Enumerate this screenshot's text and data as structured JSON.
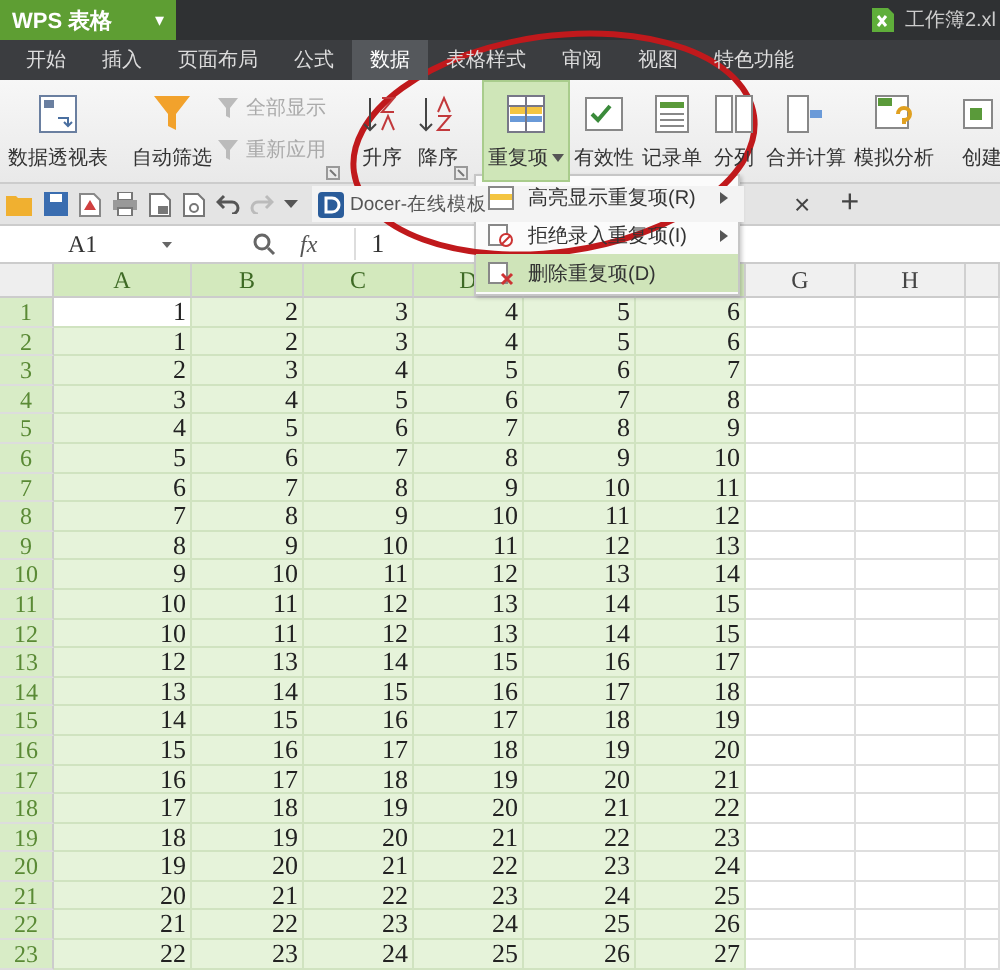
{
  "app_button": {
    "label": "WPS 表格",
    "caret": "▾"
  },
  "document_title": "工作簿2.xl",
  "tabs": [
    {
      "label": "开始",
      "selected": false
    },
    {
      "label": "插入",
      "selected": false
    },
    {
      "label": "页面布局",
      "selected": false
    },
    {
      "label": "公式",
      "selected": false
    },
    {
      "label": "数据",
      "selected": true
    },
    {
      "label": "表格样式",
      "selected": false
    },
    {
      "label": "审阅",
      "selected": false
    },
    {
      "label": "视图",
      "selected": false
    },
    {
      "label": "特色功能",
      "selected": false
    }
  ],
  "ribbon": {
    "groups": [
      {
        "launcher": false,
        "items": [
          {
            "kind": "large",
            "label": "数据透视表",
            "active": false,
            "dropdown": false
          }
        ]
      },
      {
        "launcher": true,
        "items": [
          {
            "kind": "large",
            "label": "自动筛选",
            "active": false,
            "dropdown": false
          },
          {
            "kind": "stack",
            "items": [
              {
                "label": "全部显示",
                "disabled": true
              },
              {
                "label": "重新应用",
                "disabled": true
              }
            ]
          }
        ]
      },
      {
        "launcher": true,
        "items": [
          {
            "kind": "large",
            "label": "升序",
            "active": false,
            "dropdown": false
          },
          {
            "kind": "large",
            "label": "降序",
            "active": false,
            "dropdown": false
          }
        ]
      },
      {
        "launcher": false,
        "items": [
          {
            "kind": "large",
            "label": "重复项",
            "active": true,
            "dropdown": true
          },
          {
            "kind": "large",
            "label": "有效性",
            "active": false,
            "dropdown": false
          },
          {
            "kind": "large",
            "label": "记录单",
            "active": false,
            "dropdown": false
          },
          {
            "kind": "large",
            "label": "分列",
            "active": false,
            "dropdown": false
          },
          {
            "kind": "large",
            "label": "合并计算",
            "active": false,
            "dropdown": false
          },
          {
            "kind": "large",
            "label": "模拟分析",
            "active": false,
            "dropdown": false
          }
        ]
      },
      {
        "launcher": false,
        "items": [
          {
            "kind": "large",
            "label": "创建",
            "active": false,
            "dropdown": false
          }
        ]
      }
    ]
  },
  "quick_toolbar": {
    "doc_tab": "Docer-在线模板",
    "close": "×",
    "new_tab": "+"
  },
  "formula_bar": {
    "cell_ref": "A1",
    "fx": "fx",
    "value": "1"
  },
  "menu": {
    "items": [
      {
        "label": "高亮显示重复项(R)",
        "submenu": true,
        "selected": false
      },
      {
        "label": "拒绝录入重复项(I)",
        "submenu": true,
        "selected": false
      },
      {
        "label": "删除重复项(D)",
        "submenu": false,
        "selected": true
      }
    ]
  },
  "sheet": {
    "columns": [
      {
        "label": "A",
        "selected": true
      },
      {
        "label": "B",
        "selected": true
      },
      {
        "label": "C",
        "selected": true
      },
      {
        "label": "D",
        "selected": true
      },
      {
        "selected": true
      },
      {
        "selected": true
      },
      {
        "label": "G",
        "selected": false
      },
      {
        "label": "H",
        "selected": false
      }
    ],
    "rows": [
      {
        "number": "1",
        "selected": true,
        "cells": [
          {
            "text": "1",
            "active": true
          },
          {
            "text": "2",
            "active": false
          },
          {
            "text": "3",
            "active": false
          },
          {
            "text": "4",
            "active": false
          },
          {
            "text": "5",
            "active": false
          },
          {
            "text": "6",
            "active": false
          }
        ]
      },
      {
        "number": "2",
        "selected": true,
        "cells": [
          {
            "text": "1",
            "active": false
          },
          {
            "text": "2",
            "active": false
          },
          {
            "text": "3",
            "active": false
          },
          {
            "text": "4",
            "active": false
          },
          {
            "text": "5",
            "active": false
          },
          {
            "text": "6",
            "active": false
          }
        ]
      },
      {
        "number": "3",
        "selected": true,
        "cells": [
          {
            "text": "2",
            "active": false
          },
          {
            "text": "3",
            "active": false
          },
          {
            "text": "4",
            "active": false
          },
          {
            "text": "5",
            "active": false
          },
          {
            "text": "6",
            "active": false
          },
          {
            "text": "7",
            "active": false
          }
        ]
      },
      {
        "number": "4",
        "selected": true,
        "cells": [
          {
            "text": "3",
            "active": false
          },
          {
            "text": "4",
            "active": false
          },
          {
            "text": "5",
            "active": false
          },
          {
            "text": "6",
            "active": false
          },
          {
            "text": "7",
            "active": false
          },
          {
            "text": "8",
            "active": false
          }
        ]
      },
      {
        "number": "5",
        "selected": true,
        "cells": [
          {
            "text": "4",
            "active": false
          },
          {
            "text": "5",
            "active": false
          },
          {
            "text": "6",
            "active": false
          },
          {
            "text": "7",
            "active": false
          },
          {
            "text": "8",
            "active": false
          },
          {
            "text": "9",
            "active": false
          }
        ]
      },
      {
        "number": "6",
        "selected": true,
        "cells": [
          {
            "text": "5",
            "active": false
          },
          {
            "text": "6",
            "active": false
          },
          {
            "text": "7",
            "active": false
          },
          {
            "text": "8",
            "active": false
          },
          {
            "text": "9",
            "active": false
          },
          {
            "text": "10",
            "active": false
          }
        ]
      },
      {
        "number": "7",
        "selected": true,
        "cells": [
          {
            "text": "6",
            "active": false
          },
          {
            "text": "7",
            "active": false
          },
          {
            "text": "8",
            "active": false
          },
          {
            "text": "9",
            "active": false
          },
          {
            "text": "10",
            "active": false
          },
          {
            "text": "11",
            "active": false
          }
        ]
      },
      {
        "number": "8",
        "selected": true,
        "cells": [
          {
            "text": "7",
            "active": false
          },
          {
            "text": "8",
            "active": false
          },
          {
            "text": "9",
            "active": false
          },
          {
            "text": "10",
            "active": false
          },
          {
            "text": "11",
            "active": false
          },
          {
            "text": "12",
            "active": false
          }
        ]
      },
      {
        "number": "9",
        "selected": true,
        "cells": [
          {
            "text": "8",
            "active": false
          },
          {
            "text": "9",
            "active": false
          },
          {
            "text": "10",
            "active": false
          },
          {
            "text": "11",
            "active": false
          },
          {
            "text": "12",
            "active": false
          },
          {
            "text": "13",
            "active": false
          }
        ]
      },
      {
        "number": "10",
        "selected": true,
        "cells": [
          {
            "text": "9",
            "active": false
          },
          {
            "text": "10",
            "active": false
          },
          {
            "text": "11",
            "active": false
          },
          {
            "text": "12",
            "active": false
          },
          {
            "text": "13",
            "active": false
          },
          {
            "text": "14",
            "active": false
          }
        ]
      },
      {
        "number": "11",
        "selected": true,
        "cells": [
          {
            "text": "10",
            "active": false
          },
          {
            "text": "11",
            "active": false
          },
          {
            "text": "12",
            "active": false
          },
          {
            "text": "13",
            "active": false
          },
          {
            "text": "14",
            "active": false
          },
          {
            "text": "15",
            "active": false
          }
        ]
      },
      {
        "number": "12",
        "selected": true,
        "cells": [
          {
            "text": "10",
            "active": false
          },
          {
            "text": "11",
            "active": false
          },
          {
            "text": "12",
            "active": false
          },
          {
            "text": "13",
            "active": false
          },
          {
            "text": "14",
            "active": false
          },
          {
            "text": "15",
            "active": false
          }
        ]
      },
      {
        "number": "13",
        "selected": true,
        "cells": [
          {
            "text": "12",
            "active": false
          },
          {
            "text": "13",
            "active": false
          },
          {
            "text": "14",
            "active": false
          },
          {
            "text": "15",
            "active": false
          },
          {
            "text": "16",
            "active": false
          },
          {
            "text": "17",
            "active": false
          }
        ]
      },
      {
        "number": "14",
        "selected": true,
        "cells": [
          {
            "text": "13",
            "active": false
          },
          {
            "text": "14",
            "active": false
          },
          {
            "text": "15",
            "active": false
          },
          {
            "text": "16",
            "active": false
          },
          {
            "text": "17",
            "active": false
          },
          {
            "text": "18",
            "active": false
          }
        ]
      },
      {
        "number": "15",
        "selected": true,
        "cells": [
          {
            "text": "14",
            "active": false
          },
          {
            "text": "15",
            "active": false
          },
          {
            "text": "16",
            "active": false
          },
          {
            "text": "17",
            "active": false
          },
          {
            "text": "18",
            "active": false
          },
          {
            "text": "19",
            "active": false
          }
        ]
      },
      {
        "number": "16",
        "selected": true,
        "cells": [
          {
            "text": "15",
            "active": false
          },
          {
            "text": "16",
            "active": false
          },
          {
            "text": "17",
            "active": false
          },
          {
            "text": "18",
            "active": false
          },
          {
            "text": "19",
            "active": false
          },
          {
            "text": "20",
            "active": false
          }
        ]
      },
      {
        "number": "17",
        "selected": true,
        "cells": [
          {
            "text": "16",
            "active": false
          },
          {
            "text": "17",
            "active": false
          },
          {
            "text": "18",
            "active": false
          },
          {
            "text": "19",
            "active": false
          },
          {
            "text": "20",
            "active": false
          },
          {
            "text": "21",
            "active": false
          }
        ]
      },
      {
        "number": "18",
        "selected": true,
        "cells": [
          {
            "text": "17",
            "active": false
          },
          {
            "text": "18",
            "active": false
          },
          {
            "text": "19",
            "active": false
          },
          {
            "text": "20",
            "active": false
          },
          {
            "text": "21",
            "active": false
          },
          {
            "text": "22",
            "active": false
          }
        ]
      },
      {
        "number": "19",
        "selected": true,
        "cells": [
          {
            "text": "18",
            "active": false
          },
          {
            "text": "19",
            "active": false
          },
          {
            "text": "20",
            "active": false
          },
          {
            "text": "21",
            "active": false
          },
          {
            "text": "22",
            "active": false
          },
          {
            "text": "23",
            "active": false
          }
        ]
      },
      {
        "number": "20",
        "selected": true,
        "cells": [
          {
            "text": "19",
            "active": false
          },
          {
            "text": "20",
            "active": false
          },
          {
            "text": "21",
            "active": false
          },
          {
            "text": "22",
            "active": false
          },
          {
            "text": "23",
            "active": false
          },
          {
            "text": "24",
            "active": false
          }
        ]
      },
      {
        "number": "21",
        "selected": true,
        "cells": [
          {
            "text": "20",
            "active": false
          },
          {
            "text": "21",
            "active": false
          },
          {
            "text": "22",
            "active": false
          },
          {
            "text": "23",
            "active": false
          },
          {
            "text": "24",
            "active": false
          },
          {
            "text": "25",
            "active": false
          }
        ]
      },
      {
        "number": "22",
        "selected": true,
        "cells": [
          {
            "text": "21",
            "active": false
          },
          {
            "text": "22",
            "active": false
          },
          {
            "text": "23",
            "active": false
          },
          {
            "text": "24",
            "active": false
          },
          {
            "text": "25",
            "active": false
          },
          {
            "text": "26",
            "active": false
          }
        ]
      },
      {
        "number": "23",
        "selected": true,
        "cells": [
          {
            "text": "22",
            "active": false
          },
          {
            "text": "23",
            "active": false
          },
          {
            "text": "24",
            "active": false
          },
          {
            "text": "25",
            "active": false
          },
          {
            "text": "26",
            "active": false
          },
          {
            "text": "27",
            "active": false
          }
        ]
      }
    ]
  }
}
